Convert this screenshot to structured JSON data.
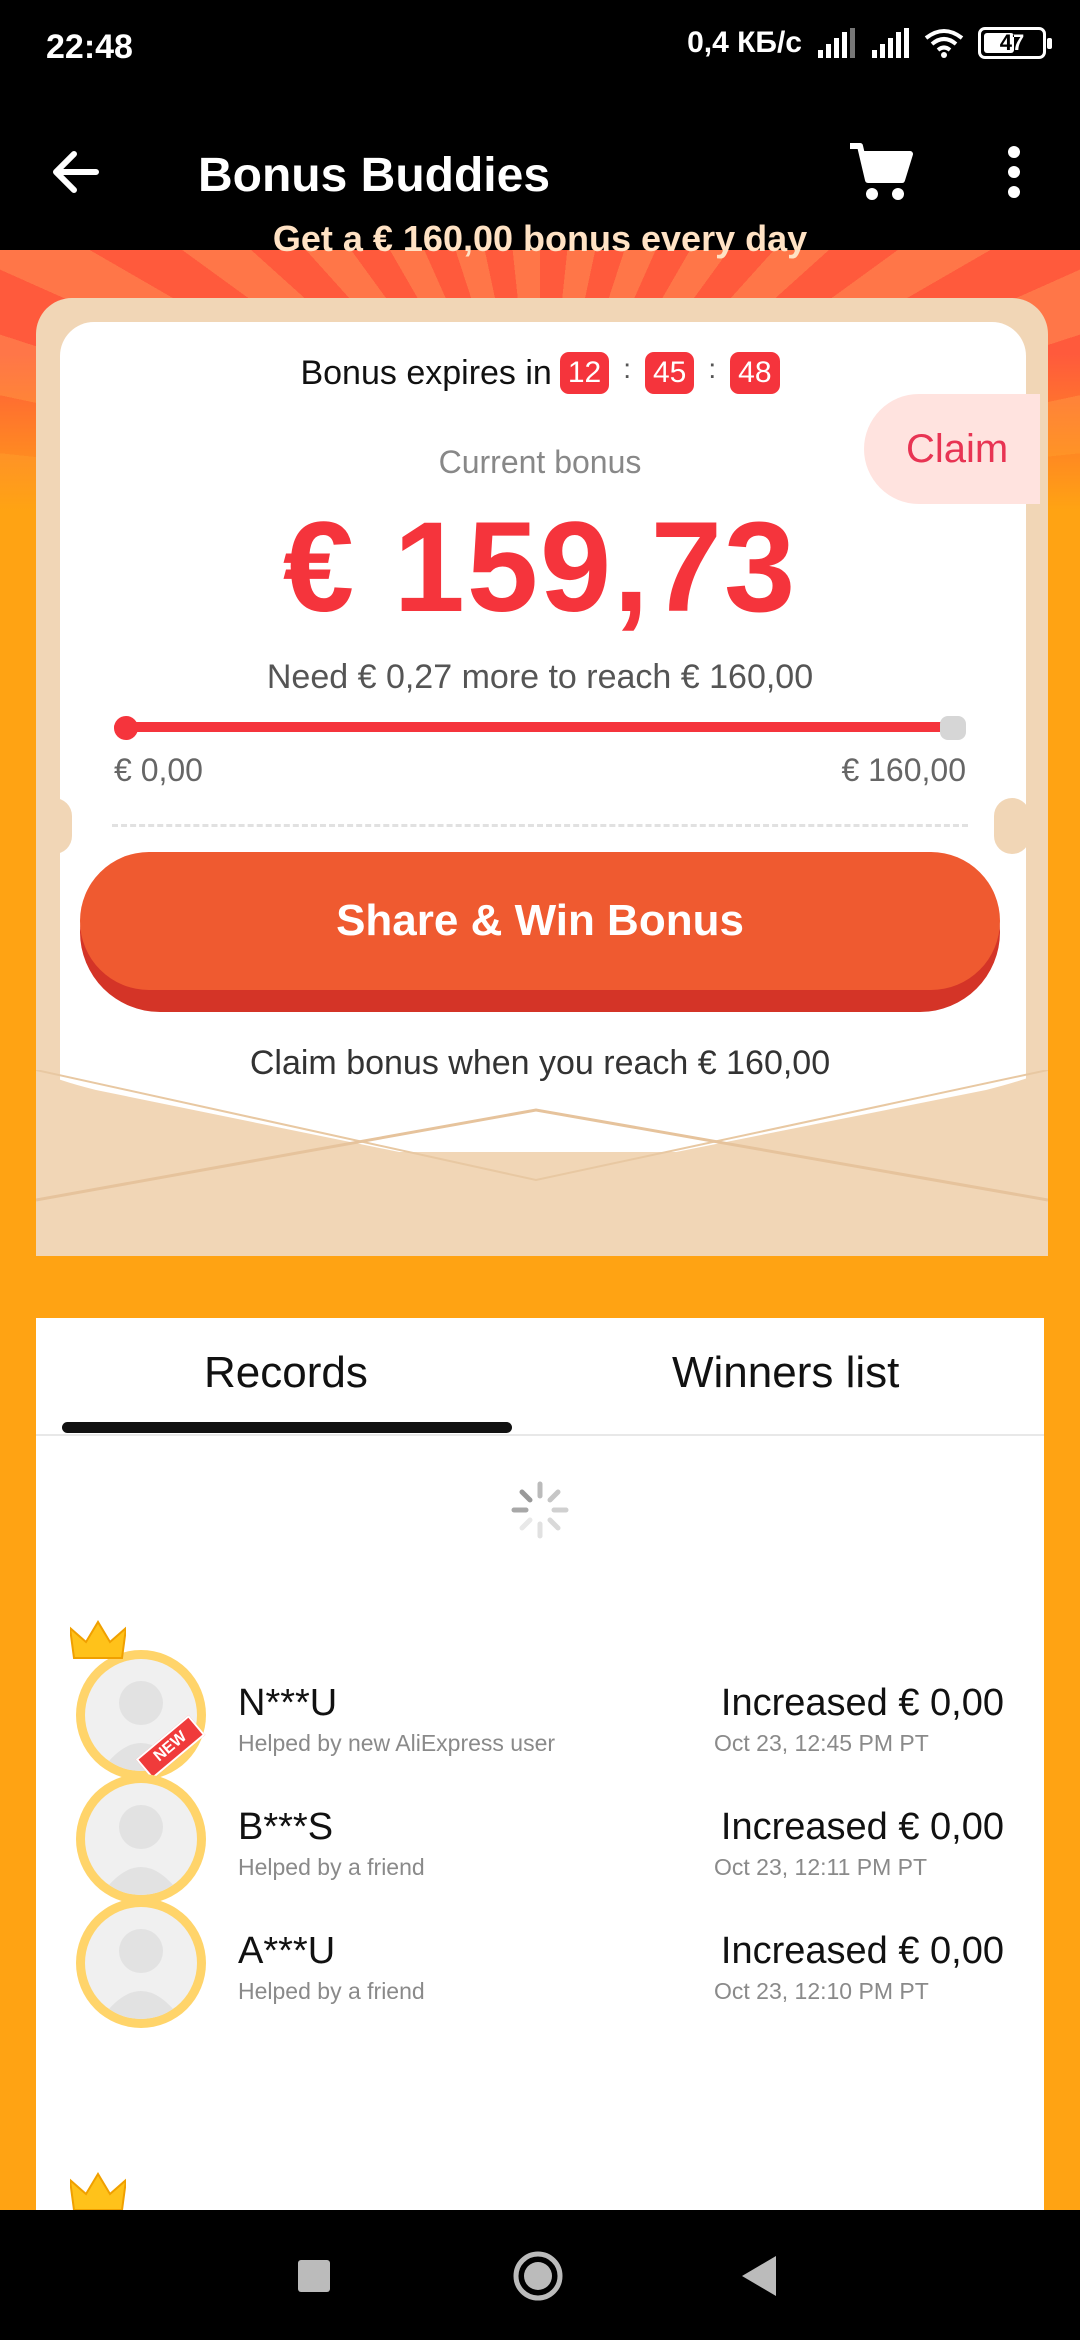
{
  "status_bar": {
    "time": "22:48",
    "speed": "0,4 КБ/с",
    "battery": "47"
  },
  "toolbar": {
    "title": "Bonus Buddies",
    "back_icon": "arrow-left-icon",
    "cart_icon": "shopping-cart-icon",
    "more_icon": "more-vertical-icon"
  },
  "banner": {
    "text": "Get a € 160,00 bonus every day"
  },
  "bonus": {
    "expires_label": "Bonus expires in",
    "timer": {
      "hours": "12",
      "minutes": "45",
      "seconds": "48",
      "separator": ":"
    },
    "claim_label": "Claim",
    "current_label": "Current bonus",
    "current_amount": "€ 159,73",
    "need_text": "Need € 0,27 more to reach € 160,00",
    "progress_fraction": 0.9983,
    "range_min": "€ 0,00",
    "range_max": "€ 160,00",
    "share_button": "Share & Win Bonus",
    "claim_hint": "Claim bonus when you reach € 160,00"
  },
  "tabs": [
    {
      "label": "Records",
      "active": true
    },
    {
      "label": "Winners list",
      "active": false
    }
  ],
  "records": [
    {
      "name": "N***U",
      "subtitle": "Helped by new AliExpress user",
      "amount": "Increased € 0,00",
      "date": "Oct 23, 12:45 PM PT",
      "crown": true,
      "badge": "NEW"
    },
    {
      "name": "B***S",
      "subtitle": "Helped by a friend",
      "amount": "Increased € 0,00",
      "date": "Oct 23, 12:11 PM PT",
      "crown": false,
      "badge": ""
    },
    {
      "name": "A***U",
      "subtitle": "Helped by a friend",
      "amount": "Increased € 0,00",
      "date": "Oct 23, 12:10 PM PT",
      "crown": false,
      "badge": ""
    }
  ],
  "colors": {
    "accent_red": "#f5343c",
    "button_orange": "#ef5a30",
    "background_orange": "#ffa313",
    "envelope": "#f1d6b6"
  }
}
